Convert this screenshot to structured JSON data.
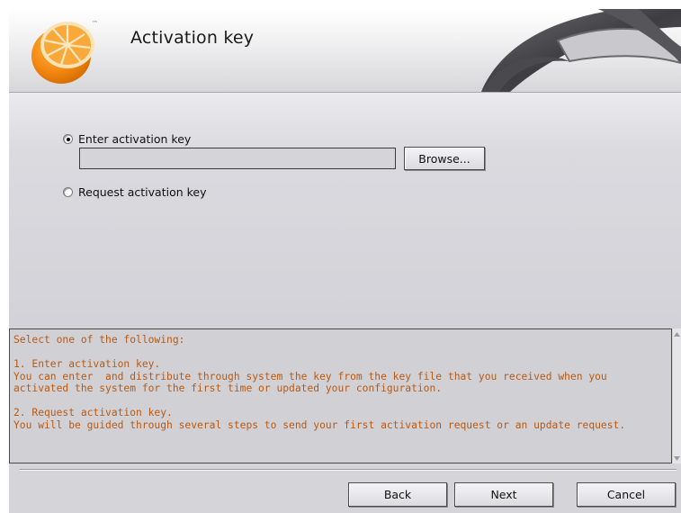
{
  "window": {
    "title": "Activation key"
  },
  "options": {
    "enter_label": "Enter activation key",
    "enter_checked": true,
    "key_value": "",
    "browse_label": "Browse...",
    "request_label": "Request activation key",
    "request_checked": false
  },
  "info": {
    "lines": [
      "Select one of the following:",
      "",
      "1. Enter activation key.",
      "You can enter  and distribute through system the key from the key file that you received when you",
      "activated the system for the first time or updated your configuration.",
      "",
      "2. Request activation key.",
      "You will be guided through several steps to send your first activation request or an update request."
    ],
    "text_color": "#b85a14"
  },
  "footer": {
    "back_label": "Back",
    "next_label": "Next",
    "cancel_label": "Cancel"
  },
  "icons": {
    "logo": "orange-slice-logo",
    "trademark": "™"
  }
}
